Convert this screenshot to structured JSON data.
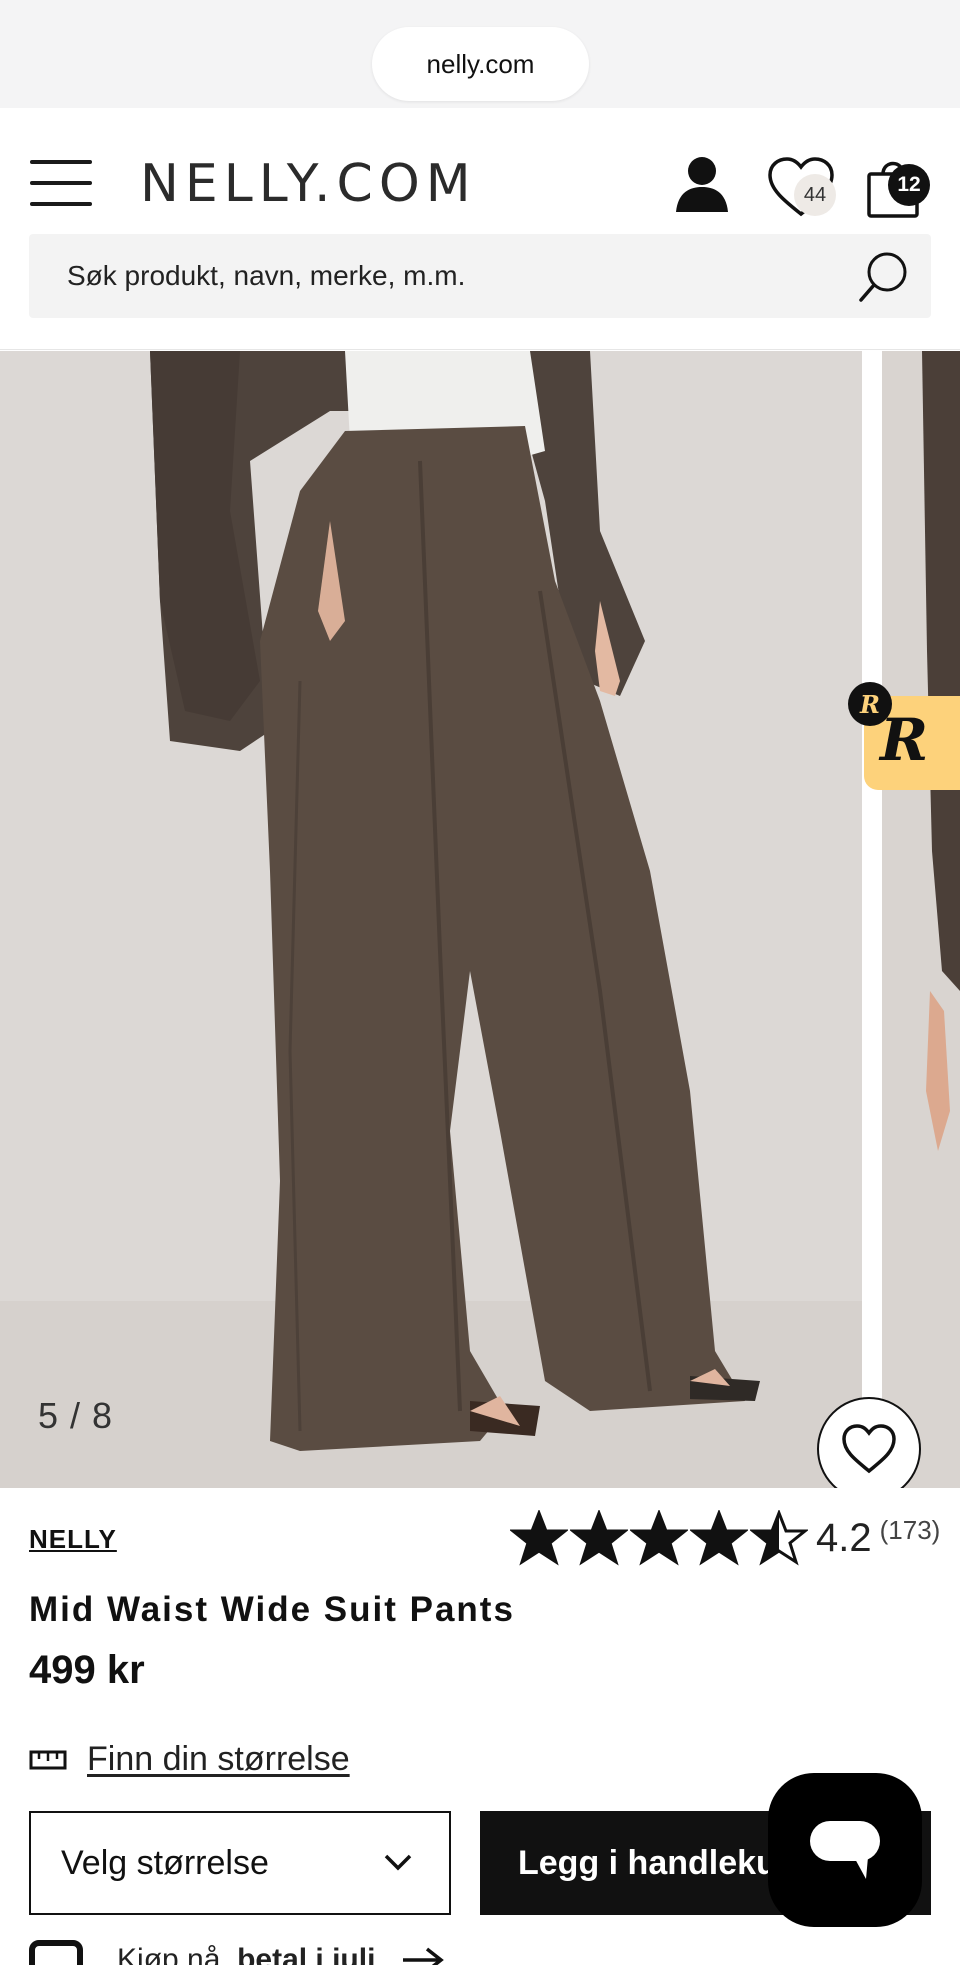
{
  "browser": {
    "url": "nelly.com"
  },
  "header": {
    "logo": "NELLY.COM",
    "wishlist_count": "44",
    "cart_count": "12",
    "search_placeholder": "Søk produkt, navn, merke, m.m."
  },
  "gallery": {
    "counter": "5 / 8",
    "current": 5,
    "total": 8,
    "badge_letter": "R"
  },
  "product": {
    "brand": "NELLY",
    "rating": "4.2",
    "rating_value": 4.2,
    "rating_max": 5,
    "review_count": "(173)",
    "title": "Mid Waist Wide Suit Pants",
    "price": "499 kr",
    "size_guide": "Finn din størrelse",
    "size_select": "Velg størrelse",
    "add_to_cart": "Legg i handlekurv",
    "payment_prefix": "Kjøp nå, ",
    "payment_bold": "betal i juli"
  },
  "colors": {
    "accent": "#111111",
    "badge_yellow": "#fdd27b",
    "pants_brown": "#5a4c42"
  }
}
